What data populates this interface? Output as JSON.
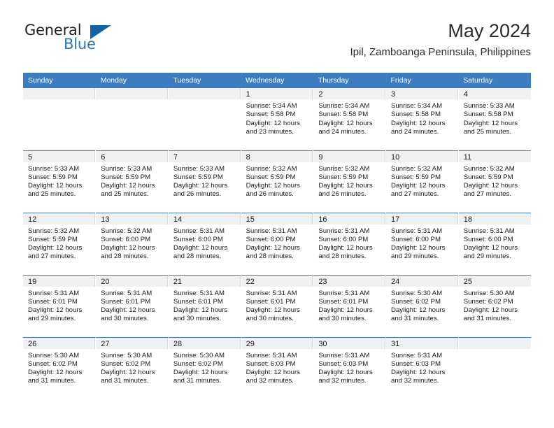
{
  "brand": {
    "name_part1": "General",
    "name_part2": "Blue",
    "triangle_color": "#1464a5",
    "blue_text_color": "#1e7bc1"
  },
  "header": {
    "title": "May 2024",
    "subtitle": "Ipil, Zamboanga Peninsula, Philippines"
  },
  "theme": {
    "header_blue": "#3b7dc0",
    "date_band_gray": "#f0f0f0"
  },
  "calendar": {
    "weekday_headers": [
      "Sunday",
      "Monday",
      "Tuesday",
      "Wednesday",
      "Thursday",
      "Friday",
      "Saturday"
    ],
    "weeks": [
      [
        {
          "day": "",
          "sunrise": "",
          "sunset": "",
          "daylight1": "",
          "daylight2": "",
          "empty": true
        },
        {
          "day": "",
          "sunrise": "",
          "sunset": "",
          "daylight1": "",
          "daylight2": "",
          "empty": true
        },
        {
          "day": "",
          "sunrise": "",
          "sunset": "",
          "daylight1": "",
          "daylight2": "",
          "empty": true
        },
        {
          "day": "1",
          "sunrise": "Sunrise: 5:34 AM",
          "sunset": "Sunset: 5:58 PM",
          "daylight1": "Daylight: 12 hours",
          "daylight2": "and 23 minutes."
        },
        {
          "day": "2",
          "sunrise": "Sunrise: 5:34 AM",
          "sunset": "Sunset: 5:58 PM",
          "daylight1": "Daylight: 12 hours",
          "daylight2": "and 24 minutes."
        },
        {
          "day": "3",
          "sunrise": "Sunrise: 5:34 AM",
          "sunset": "Sunset: 5:58 PM",
          "daylight1": "Daylight: 12 hours",
          "daylight2": "and 24 minutes."
        },
        {
          "day": "4",
          "sunrise": "Sunrise: 5:33 AM",
          "sunset": "Sunset: 5:58 PM",
          "daylight1": "Daylight: 12 hours",
          "daylight2": "and 25 minutes."
        }
      ],
      [
        {
          "day": "5",
          "sunrise": "Sunrise: 5:33 AM",
          "sunset": "Sunset: 5:59 PM",
          "daylight1": "Daylight: 12 hours",
          "daylight2": "and 25 minutes."
        },
        {
          "day": "6",
          "sunrise": "Sunrise: 5:33 AM",
          "sunset": "Sunset: 5:59 PM",
          "daylight1": "Daylight: 12 hours",
          "daylight2": "and 25 minutes."
        },
        {
          "day": "7",
          "sunrise": "Sunrise: 5:33 AM",
          "sunset": "Sunset: 5:59 PM",
          "daylight1": "Daylight: 12 hours",
          "daylight2": "and 26 minutes."
        },
        {
          "day": "8",
          "sunrise": "Sunrise: 5:32 AM",
          "sunset": "Sunset: 5:59 PM",
          "daylight1": "Daylight: 12 hours",
          "daylight2": "and 26 minutes."
        },
        {
          "day": "9",
          "sunrise": "Sunrise: 5:32 AM",
          "sunset": "Sunset: 5:59 PM",
          "daylight1": "Daylight: 12 hours",
          "daylight2": "and 26 minutes."
        },
        {
          "day": "10",
          "sunrise": "Sunrise: 5:32 AM",
          "sunset": "Sunset: 5:59 PM",
          "daylight1": "Daylight: 12 hours",
          "daylight2": "and 27 minutes."
        },
        {
          "day": "11",
          "sunrise": "Sunrise: 5:32 AM",
          "sunset": "Sunset: 5:59 PM",
          "daylight1": "Daylight: 12 hours",
          "daylight2": "and 27 minutes."
        }
      ],
      [
        {
          "day": "12",
          "sunrise": "Sunrise: 5:32 AM",
          "sunset": "Sunset: 5:59 PM",
          "daylight1": "Daylight: 12 hours",
          "daylight2": "and 27 minutes."
        },
        {
          "day": "13",
          "sunrise": "Sunrise: 5:32 AM",
          "sunset": "Sunset: 6:00 PM",
          "daylight1": "Daylight: 12 hours",
          "daylight2": "and 28 minutes."
        },
        {
          "day": "14",
          "sunrise": "Sunrise: 5:31 AM",
          "sunset": "Sunset: 6:00 PM",
          "daylight1": "Daylight: 12 hours",
          "daylight2": "and 28 minutes."
        },
        {
          "day": "15",
          "sunrise": "Sunrise: 5:31 AM",
          "sunset": "Sunset: 6:00 PM",
          "daylight1": "Daylight: 12 hours",
          "daylight2": "and 28 minutes."
        },
        {
          "day": "16",
          "sunrise": "Sunrise: 5:31 AM",
          "sunset": "Sunset: 6:00 PM",
          "daylight1": "Daylight: 12 hours",
          "daylight2": "and 28 minutes."
        },
        {
          "day": "17",
          "sunrise": "Sunrise: 5:31 AM",
          "sunset": "Sunset: 6:00 PM",
          "daylight1": "Daylight: 12 hours",
          "daylight2": "and 29 minutes."
        },
        {
          "day": "18",
          "sunrise": "Sunrise: 5:31 AM",
          "sunset": "Sunset: 6:00 PM",
          "daylight1": "Daylight: 12 hours",
          "daylight2": "and 29 minutes."
        }
      ],
      [
        {
          "day": "19",
          "sunrise": "Sunrise: 5:31 AM",
          "sunset": "Sunset: 6:01 PM",
          "daylight1": "Daylight: 12 hours",
          "daylight2": "and 29 minutes."
        },
        {
          "day": "20",
          "sunrise": "Sunrise: 5:31 AM",
          "sunset": "Sunset: 6:01 PM",
          "daylight1": "Daylight: 12 hours",
          "daylight2": "and 30 minutes."
        },
        {
          "day": "21",
          "sunrise": "Sunrise: 5:31 AM",
          "sunset": "Sunset: 6:01 PM",
          "daylight1": "Daylight: 12 hours",
          "daylight2": "and 30 minutes."
        },
        {
          "day": "22",
          "sunrise": "Sunrise: 5:31 AM",
          "sunset": "Sunset: 6:01 PM",
          "daylight1": "Daylight: 12 hours",
          "daylight2": "and 30 minutes."
        },
        {
          "day": "23",
          "sunrise": "Sunrise: 5:31 AM",
          "sunset": "Sunset: 6:01 PM",
          "daylight1": "Daylight: 12 hours",
          "daylight2": "and 30 minutes."
        },
        {
          "day": "24",
          "sunrise": "Sunrise: 5:30 AM",
          "sunset": "Sunset: 6:02 PM",
          "daylight1": "Daylight: 12 hours",
          "daylight2": "and 31 minutes."
        },
        {
          "day": "25",
          "sunrise": "Sunrise: 5:30 AM",
          "sunset": "Sunset: 6:02 PM",
          "daylight1": "Daylight: 12 hours",
          "daylight2": "and 31 minutes."
        }
      ],
      [
        {
          "day": "26",
          "sunrise": "Sunrise: 5:30 AM",
          "sunset": "Sunset: 6:02 PM",
          "daylight1": "Daylight: 12 hours",
          "daylight2": "and 31 minutes."
        },
        {
          "day": "27",
          "sunrise": "Sunrise: 5:30 AM",
          "sunset": "Sunset: 6:02 PM",
          "daylight1": "Daylight: 12 hours",
          "daylight2": "and 31 minutes."
        },
        {
          "day": "28",
          "sunrise": "Sunrise: 5:30 AM",
          "sunset": "Sunset: 6:02 PM",
          "daylight1": "Daylight: 12 hours",
          "daylight2": "and 31 minutes."
        },
        {
          "day": "29",
          "sunrise": "Sunrise: 5:31 AM",
          "sunset": "Sunset: 6:03 PM",
          "daylight1": "Daylight: 12 hours",
          "daylight2": "and 32 minutes."
        },
        {
          "day": "30",
          "sunrise": "Sunrise: 5:31 AM",
          "sunset": "Sunset: 6:03 PM",
          "daylight1": "Daylight: 12 hours",
          "daylight2": "and 32 minutes."
        },
        {
          "day": "31",
          "sunrise": "Sunrise: 5:31 AM",
          "sunset": "Sunset: 6:03 PM",
          "daylight1": "Daylight: 12 hours",
          "daylight2": "and 32 minutes."
        },
        {
          "day": "",
          "sunrise": "",
          "sunset": "",
          "daylight1": "",
          "daylight2": "",
          "empty": true
        }
      ]
    ]
  }
}
